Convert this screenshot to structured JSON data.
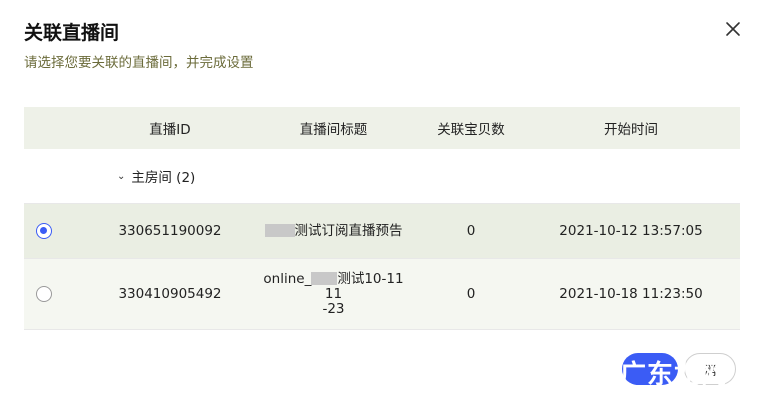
{
  "dialog": {
    "title": "关联直播间",
    "subtitle": "请选择您要关联的直播间，并完成设置",
    "close_icon": "close-icon"
  },
  "table": {
    "headers": {
      "room_id": "直播ID",
      "title": "直播间标题",
      "product_count": "关联宝贝数",
      "start_time": "开始时间"
    },
    "group": {
      "label": "主房间 (2)",
      "icon": "chevron-down-icon"
    },
    "rows": [
      {
        "selected": true,
        "room_id": "330651190092",
        "title_suffix": "测试订阅直播预告",
        "product_count": "0",
        "start_time": "2021-10-12 13:57:05"
      },
      {
        "selected": false,
        "room_id": "330410905492",
        "title_prefix": "online_",
        "title_suffix": "测试10-11 11",
        "title_line2": "-23",
        "product_count": "0",
        "start_time": "2021-10-18 11:23:50"
      }
    ]
  },
  "footer": {
    "cancel_label": "消"
  },
  "watermark": "广东龙网",
  "colors": {
    "accent": "#3b5cf5",
    "header_bg": "#eef1e8",
    "selected_row_bg": "#eaeee3",
    "subtitle": "#6b6b3a"
  }
}
